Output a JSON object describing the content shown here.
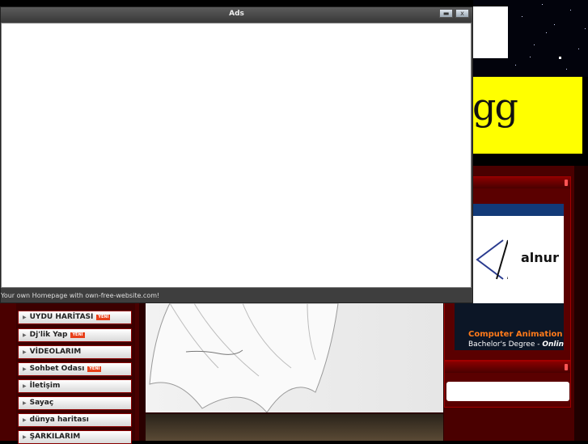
{
  "ads_window": {
    "title": "Ads",
    "minimize_symbol": "▬",
    "close_symbol": "x",
    "footer_text": "Your own Homepage with own-free-website.com!"
  },
  "banner": {
    "text": "gg"
  },
  "nav": {
    "items": [
      {
        "label": "UYDU HARİTASI",
        "badge": "YENİ"
      },
      {
        "label": "Dj'lik Yap",
        "badge": "YENİ"
      },
      {
        "label": "VİDEOLARIM",
        "badge": ""
      },
      {
        "label": "Sohbet Odası",
        "badge": "YENİ"
      },
      {
        "label": "İletişim",
        "badge": ""
      },
      {
        "label": "Sayaç",
        "badge": ""
      },
      {
        "label": "dünya haritası",
        "badge": ""
      },
      {
        "label": "ŞARKILARIM",
        "badge": ""
      }
    ],
    "arrow_icon": "▶"
  },
  "ad_panel": {
    "logo_text": "alnur",
    "ca_title": "Computer Animation",
    "ca_sub_prefix": "Bachelor's Degree - ",
    "ca_sub_emph": "Online"
  },
  "colors": {
    "frame": "#4a0000",
    "accent_red": "#a00000",
    "banner_yellow": "#ffff00",
    "badge": "#e8401a"
  }
}
